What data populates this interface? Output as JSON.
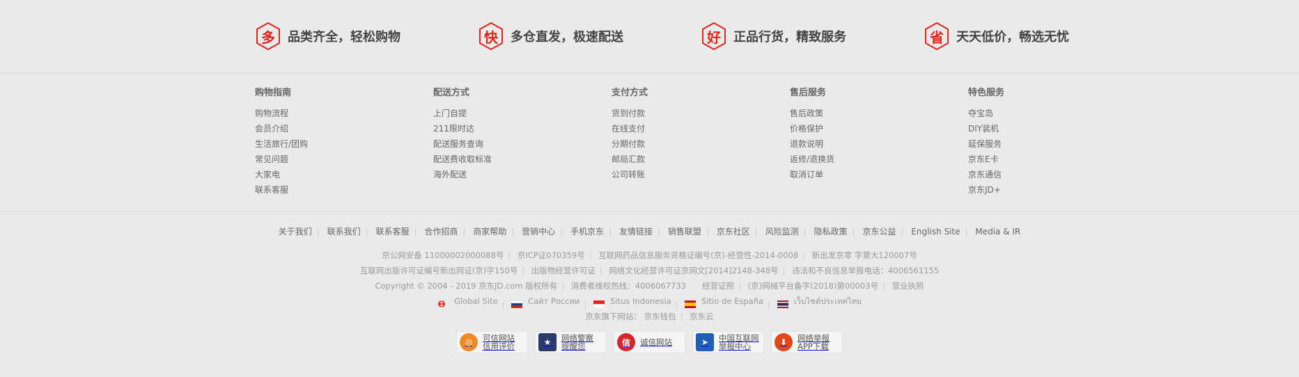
{
  "slogans": [
    {
      "char": "多",
      "text": "品类齐全，轻松购物"
    },
    {
      "char": "快",
      "text": "多仓直发，极速配送"
    },
    {
      "char": "好",
      "text": "正品行货，精致服务"
    },
    {
      "char": "省",
      "text": "天天低价，畅选无忧"
    }
  ],
  "columns": [
    {
      "title": "购物指南",
      "items": [
        "购物流程",
        "会员介绍",
        "生活旅行/团购",
        "常见问题",
        "大家电",
        "联系客服"
      ]
    },
    {
      "title": "配送方式",
      "items": [
        "上门自提",
        "211限时达",
        "配送服务查询",
        "配送费收取标准",
        "海外配送"
      ]
    },
    {
      "title": "支付方式",
      "items": [
        "货到付款",
        "在线支付",
        "分期付款",
        "邮局汇款",
        "公司转账"
      ]
    },
    {
      "title": "售后服务",
      "items": [
        "售后政策",
        "价格保护",
        "退款说明",
        "返修/退换货",
        "取消订单"
      ]
    },
    {
      "title": "特色服务",
      "items": [
        "夺宝岛",
        "DIY装机",
        "延保服务",
        "京东E卡",
        "京东通信",
        "京东JD+"
      ]
    }
  ],
  "links": [
    "关于我们",
    "联系我们",
    "联系客服",
    "合作招商",
    "商家帮助",
    "营销中心",
    "手机京东",
    "友情链接",
    "销售联盟",
    "京东社区",
    "风险监测",
    "隐私政策",
    "京东公益",
    "English Site",
    "Media & IR"
  ],
  "copyright": {
    "row1": [
      "京公网安备 11000002000088号",
      "京ICP证070359号",
      "互联网药品信息服务资格证编号(京)-经营性-2014-0008",
      "新出发京零 字第大120007号"
    ],
    "row2": [
      "互联网出版许可证编号新出网证(京)字150号",
      "出版物经营许可证",
      "网络文化经营许可证京网文[2014]2148-348号",
      "违法和不良信息举报电话：4006561155"
    ],
    "row3": [
      "Copyright © 2004 - 2019 京东JD.com 版权所有",
      "消费者维权热线：4006067733",
      "经营证照",
      "(京)网械平台备字(2018)第00003号",
      "营业执照"
    ],
    "intl": [
      "Global Site",
      "Сайт России",
      "Situs Indonesia",
      "Sitio de España",
      "เว็บไซต์ประเทศไทย"
    ],
    "sub_label": "京东旗下网站：",
    "sub_sites": [
      "京东钱包",
      "京东云"
    ]
  },
  "badges": [
    {
      "line1": "可信网站",
      "line2": "信用评价",
      "icon": "trusted-site-icon",
      "color": "#f08a24"
    },
    {
      "line1": "网络警察",
      "line2": "提醒您",
      "icon": "police-icon",
      "color": "#2a3a6a"
    },
    {
      "line1": "诚信网站",
      "line2": "",
      "icon": "credit-site-icon",
      "color": "#d8262b"
    },
    {
      "line1": "中国互联网",
      "line2": "举报中心",
      "icon": "report-center-icon",
      "color": "#1f5fb5"
    },
    {
      "line1": "网络举报",
      "line2": "APP下载",
      "icon": "report-app-icon",
      "color": "#e2471c"
    }
  ]
}
